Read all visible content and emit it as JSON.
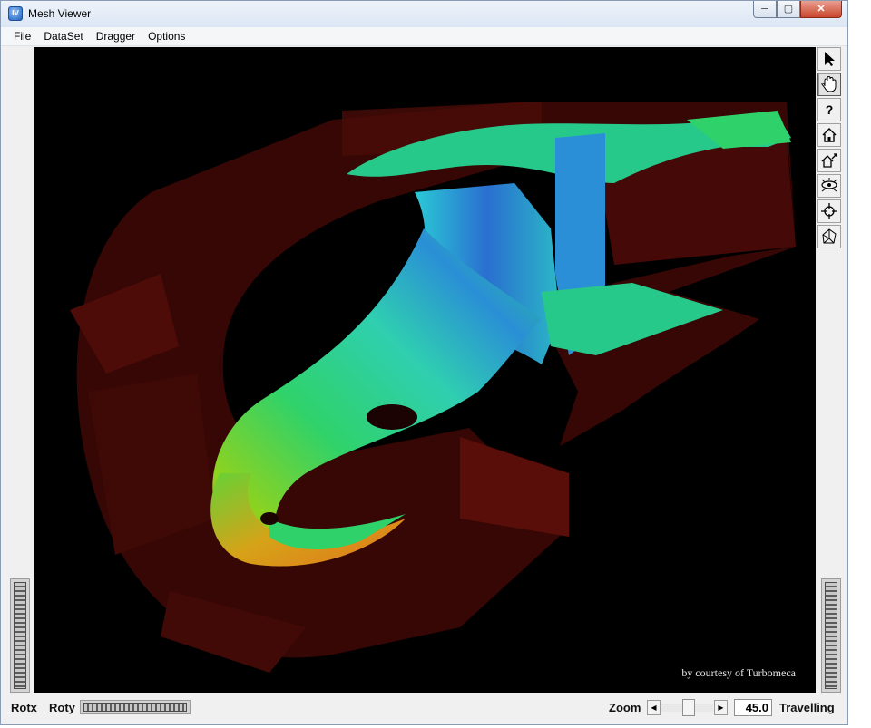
{
  "window": {
    "title": "Mesh Viewer",
    "icon": "app-icon"
  },
  "menu": [
    "File",
    "DataSet",
    "Dragger",
    "Options"
  ],
  "viewer": {
    "credit": "by courtesy of Turbomeca",
    "background": "#000000"
  },
  "toolbar": [
    {
      "name": "select-arrow-icon",
      "active": false
    },
    {
      "name": "hand-view-icon",
      "active": true
    },
    {
      "name": "help-icon",
      "active": false
    },
    {
      "name": "home-icon",
      "active": false
    },
    {
      "name": "set-home-icon",
      "active": false
    },
    {
      "name": "view-all-icon",
      "active": false
    },
    {
      "name": "seek-icon",
      "active": false
    },
    {
      "name": "projection-icon",
      "active": false
    }
  ],
  "bottom": {
    "rotx_label": "Rotx",
    "roty_label": "Roty",
    "zoom_label": "Zoom",
    "zoom_value": "45.0",
    "travel_label": "Travelling"
  },
  "colors": {
    "mesh_shell": "#4a0b08",
    "accent_green": "#2fd26a",
    "accent_blue": "#2a7fd6"
  }
}
